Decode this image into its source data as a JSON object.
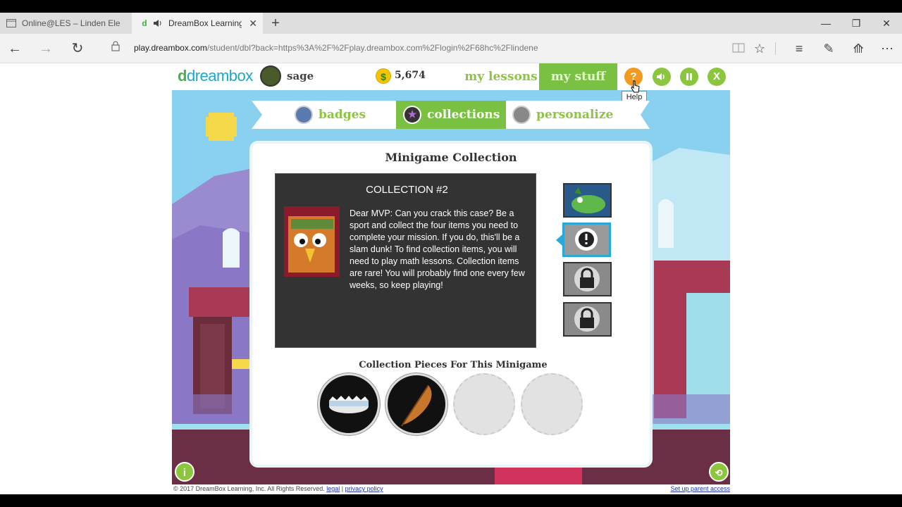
{
  "browser": {
    "tabs": [
      {
        "label": "Online@LES – Linden Eleme",
        "active": false
      },
      {
        "label": "DreamBox Learning",
        "active": true
      }
    ],
    "new_tab": "+",
    "url_host": "play.dreambox.com",
    "url_path": "/student/dbl?back=https%3A%2F%2Fplay.dreambox.com%2Flogin%2F68hc%2Flindene",
    "window_controls": [
      "minimize",
      "restore",
      "close"
    ]
  },
  "game": {
    "logo": "dreambox",
    "username": "sage",
    "coins": "5,674",
    "coin_symbol": "$",
    "nav": {
      "my_lessons": "my lessons",
      "my_stuff": "my stuff"
    },
    "buttons": {
      "help": "?",
      "sound": "sound",
      "pause": "pause",
      "close": "X"
    },
    "tooltip": "Help",
    "tabs": [
      {
        "label": "badges",
        "active": false
      },
      {
        "label": "collections",
        "active": true
      },
      {
        "label": "personalize",
        "active": false
      }
    ],
    "panel_title": "Minigame Collection",
    "collection_title": "COLLECTION #2",
    "collection_text": "Dear MVP: Can you crack this case? Be a sport and collect the four items you need to complete your mission. If you do, this'll be a slam dunk! To find collection items, you will need to play math lessons. Collection items are rare! You will probably find one every few weeks, so keep playing!",
    "pieces_title": "Collection Pieces For This Minigame",
    "collections": [
      {
        "status": "unlocked",
        "icon": "dragon-icon"
      },
      {
        "status": "selected",
        "icon": "exclamation-icon"
      },
      {
        "status": "locked",
        "icon": "lock-icon"
      },
      {
        "status": "locked",
        "icon": "lock-icon"
      }
    ],
    "pieces": [
      {
        "status": "collected",
        "icon": "crown-icon"
      },
      {
        "status": "collected",
        "icon": "feather-icon"
      },
      {
        "status": "empty"
      },
      {
        "status": "empty"
      }
    ]
  },
  "footer": {
    "copyright": "© 2017 DreamBox Learning, Inc. All Rights Reserved.",
    "legal": "legal",
    "divider": "|",
    "privacy": "privacy policy",
    "parent_access": "Set up parent access"
  },
  "colors": {
    "accent_green": "#7ac143",
    "light_green": "#8cc63f",
    "sky": "#8ad0ef",
    "selection_blue": "#2aa8d8",
    "help_orange": "#f29a1f"
  }
}
